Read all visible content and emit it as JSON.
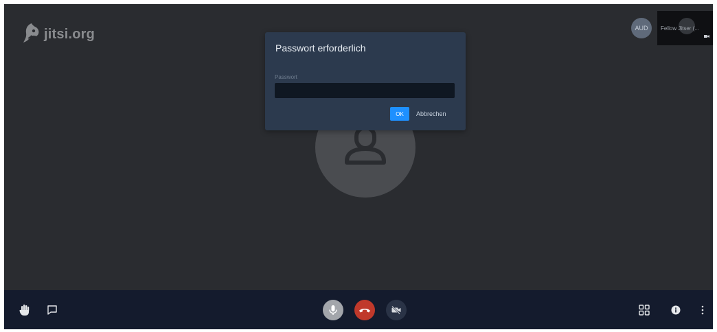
{
  "logo": {
    "text": "jitsi.org",
    "icon": "jitsi-logo-icon"
  },
  "participant": {
    "initials": "AUD",
    "thumbnail_label": "Fellow Jitser (..."
  },
  "dialog": {
    "title": "Passwort erforderlich",
    "field_label": "Passwort",
    "password_value": "",
    "ok_label": "OK",
    "cancel_label": "Abbrechen"
  },
  "toolbar": {
    "left": [
      "raise-hand-icon",
      "chat-icon"
    ],
    "center": [
      "microphone-icon",
      "hangup-icon",
      "camera-off-icon"
    ],
    "right": [
      "tile-view-icon",
      "info-icon",
      "more-options-icon"
    ]
  },
  "colors": {
    "background": "#2a2c30",
    "toolbar": "#141b2d",
    "dialog": "#2c3a4e",
    "accent": "#1e90ff",
    "hangup": "#c0392b"
  }
}
